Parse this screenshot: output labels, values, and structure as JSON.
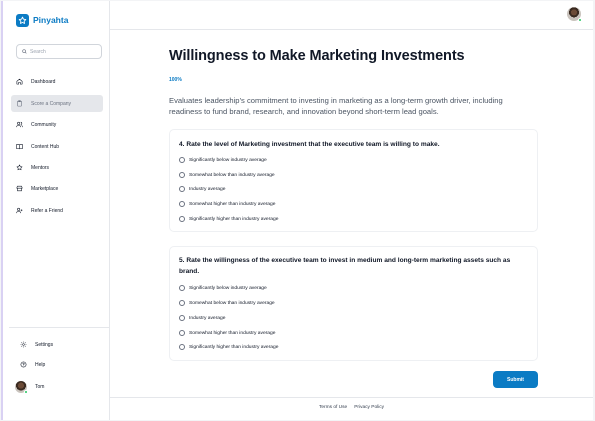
{
  "app": {
    "name": "Pinyahta",
    "accent": "#0b7bc4"
  },
  "search": {
    "placeholder": "Search"
  },
  "sidebar": {
    "items": [
      {
        "label": "Dashboard",
        "icon": "home-icon"
      },
      {
        "label": "Score a Company",
        "icon": "clipboard-icon",
        "active": true
      },
      {
        "label": "Community",
        "icon": "users-icon"
      },
      {
        "label": "Content Hub",
        "icon": "book-icon"
      },
      {
        "label": "Mentors",
        "icon": "star-icon"
      },
      {
        "label": "Marketplace",
        "icon": "store-icon"
      },
      {
        "label": "Refer a Friend",
        "icon": "user-plus-icon"
      }
    ],
    "bottom": [
      {
        "label": "Settings",
        "icon": "gear-icon"
      },
      {
        "label": "Help",
        "icon": "help-circle-icon"
      }
    ],
    "user": {
      "name": "Tom"
    }
  },
  "main": {
    "title": "Willingness to Make Marketing Investments",
    "progress": "100%",
    "description": "Evaluates leadership’s commitment to investing in marketing as a long-term growth driver, including readiness to fund brand, research, and innovation beyond short-term lead goals.",
    "questions": [
      {
        "text": "4. Rate the level of Marketing investment that the executive team is willing to make.",
        "options": [
          "Significantly below industry average",
          "Somewhat below than industry average",
          "Industry average",
          "Somewhat higher than industry average",
          "Significantly higher than industry average"
        ]
      },
      {
        "text": "5. Rate the willingness of the executive team to invest in medium and long-term marketing assets such as brand.",
        "options": [
          "Significantly below industry average",
          "Somewhat below than industry average",
          "Industry average",
          "Somewhat higher than industry average",
          "Significantly higher than industry average"
        ]
      }
    ],
    "submit_label": "Submit"
  },
  "footer": {
    "terms": "Terms of Use",
    "privacy": "Privacy Policy"
  }
}
